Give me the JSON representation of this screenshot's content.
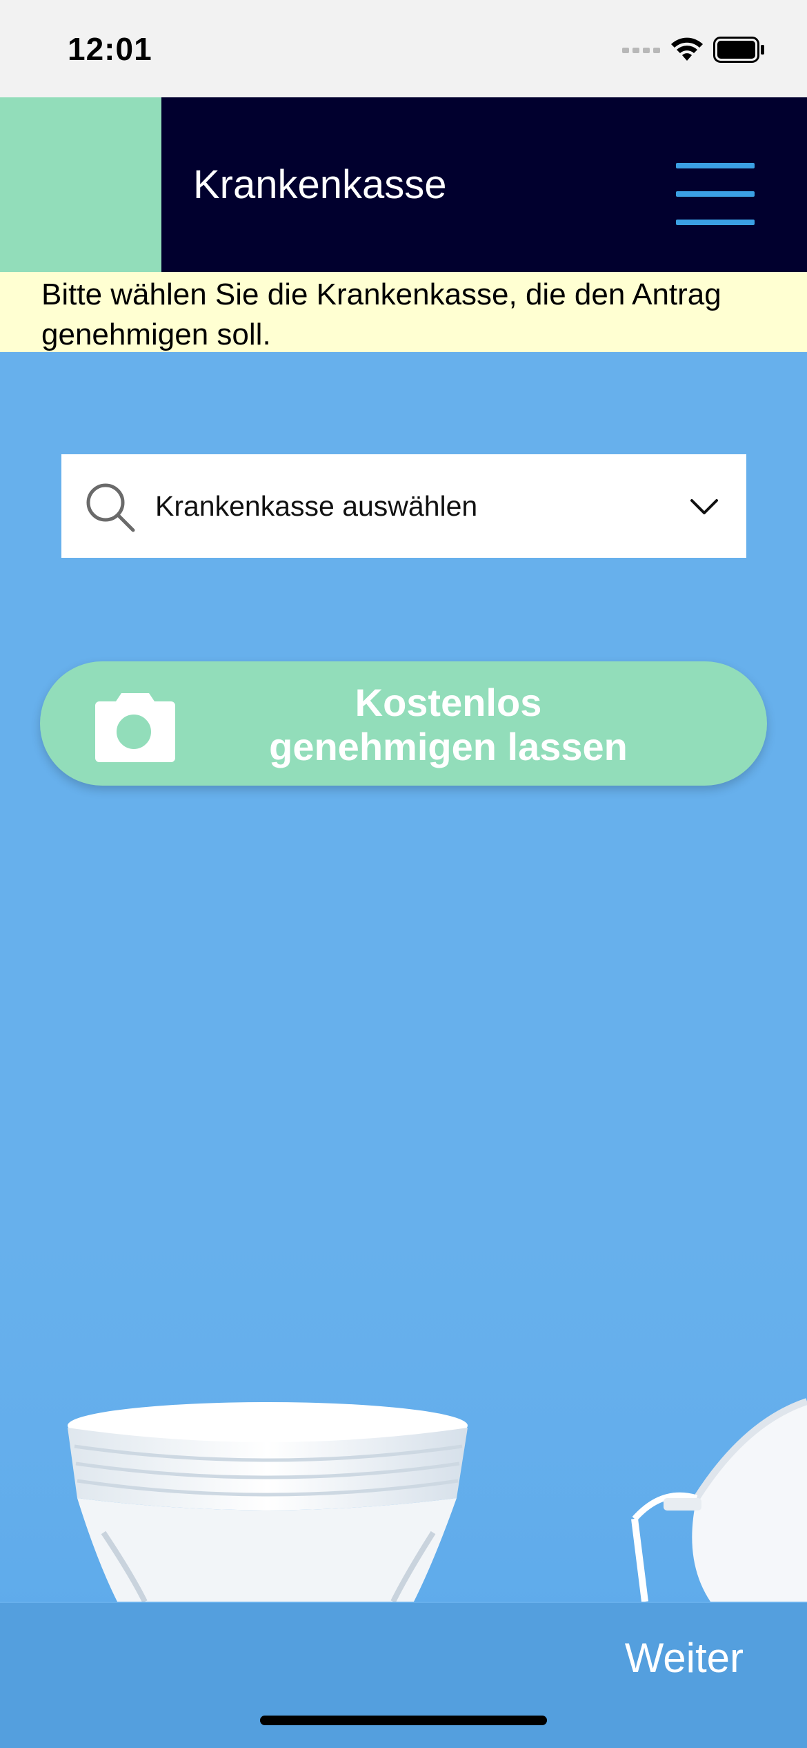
{
  "status_bar": {
    "time": "12:01"
  },
  "header": {
    "title": "Krankenkasse",
    "menu_icon": "hamburger-menu-icon",
    "colors": {
      "background": "#01002e",
      "accent": "#92ddba",
      "menu": "#3ba0e4"
    }
  },
  "notice": {
    "text": "Bitte wählen Sie die Krankenkasse, die den Antrag genehmigen soll."
  },
  "insurer_select": {
    "placeholder": "Krankenkasse auswählen",
    "search_icon": "search-icon",
    "chevron_icon": "chevron-down-icon"
  },
  "cta": {
    "line1": "Kostenlos",
    "line2": "genehmigen lassen",
    "icon": "camera-icon",
    "color": "#92ddba"
  },
  "footer": {
    "next_label": "Weiter",
    "color": "#549fde"
  },
  "background_color": "#67b0ec"
}
